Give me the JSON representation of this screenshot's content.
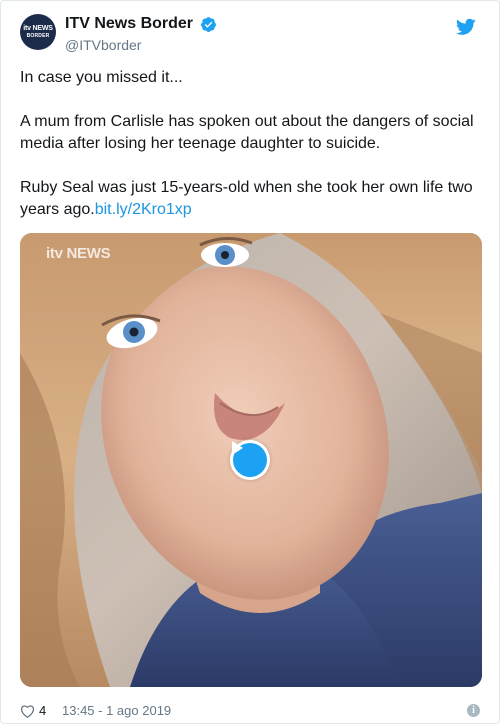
{
  "tweet": {
    "author": {
      "display_name": "ITV News Border",
      "handle": "@ITVborder",
      "avatar_text_top": "itv NEWS",
      "avatar_text_bottom": "BORDER",
      "verified": true
    },
    "text": {
      "line1": "In case you missed it...",
      "paragraph2": "A mum from Carlisle has spoken out about the dangers of social media after losing her teenage daughter to suicide.",
      "paragraph3": "Ruby Seal was just 15-years-old when she took her own life two years ago.",
      "link": "bit.ly/2Kro1xp"
    },
    "media": {
      "type": "video",
      "watermark": "itv NEWS"
    },
    "footer": {
      "likes": "4",
      "timestamp": "13:45 - 1 ago 2019"
    }
  },
  "colors": {
    "link": "#1b95e0",
    "twitter_blue": "#1da1f2",
    "secondary_text": "#657786"
  },
  "icons": {
    "bird": "twitter-bird-icon",
    "verified": "verified-badge-icon",
    "play": "play-icon",
    "heart": "heart-icon",
    "info": "info-icon"
  }
}
